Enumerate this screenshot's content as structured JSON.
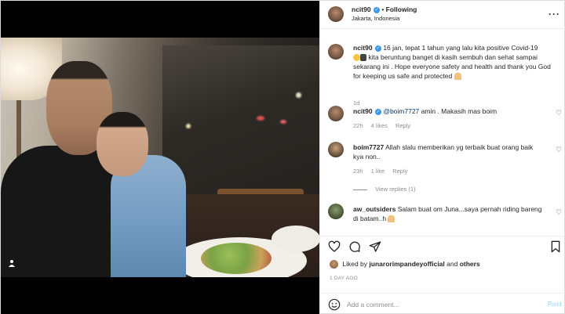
{
  "post": {
    "username": "ncit90",
    "follow_label": "Following",
    "location": "Jakarta, Indonesia"
  },
  "caption": {
    "username": "ncit90",
    "text_1": "16 jan, tepat 1 tahun yang lalu kita positive Covid-19",
    "text_2": "kita beruntung banget di kasih sembuh dan sehat sampai",
    "text_3": "sekarang ini . Hope everyone safety and health and thank you God",
    "text_4": "for keeping us safe and protected",
    "time": "1d"
  },
  "comments": [
    {
      "username": "ncit90",
      "mention": "@boim7727",
      "text": " amin . Makasih mas boim",
      "time": "22h",
      "likes": "4 likes",
      "reply": "Reply"
    },
    {
      "username": "boim7727",
      "text_1": "Allah slalu memberikan yg terbaik buat orang baik",
      "text_2": "kya non..",
      "time": "23h",
      "likes": "1 like",
      "reply": "Reply",
      "view_replies": "View replies (1)"
    },
    {
      "username": "aw_outsiders",
      "text_1": "Salam buat om Juna...saya pernah riding bareng",
      "text_2": "di batam..h"
    }
  ],
  "likes": {
    "prefix": "Liked by",
    "user": "junarorimpandeyofficial",
    "and": "and",
    "others": "others"
  },
  "posted_ago": "1 DAY AGO",
  "add_comment": {
    "placeholder": "Add a comment...",
    "post_label": "Post"
  }
}
